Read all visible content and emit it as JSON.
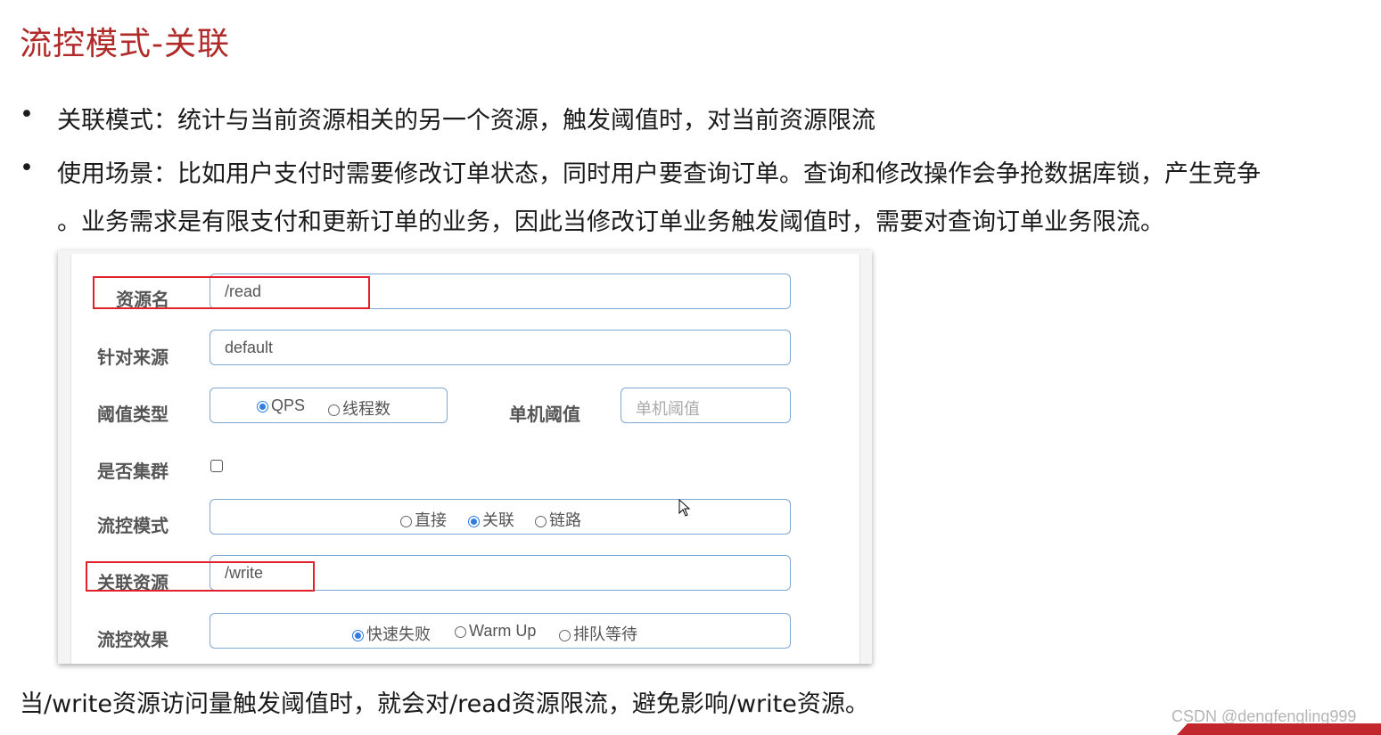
{
  "title": "流控模式-关联",
  "bullets": [
    {
      "symbol": "•",
      "text": "关联模式：统计与当前资源相关的另一个资源，触发阈值时，对当前资源限流"
    },
    {
      "symbol": "•",
      "text": "使用场景：比如用户支付时需要修改订单状态，同时用户要查询订单。查询和修改操作会争抢数据库锁，产生竞争",
      "text_line2": "。业务需求是有限支付和更新订单的业务，因此当修改订单业务触发阈值时，需要对查询订单业务限流。"
    }
  ],
  "form": {
    "resource_name": {
      "label": "资源名",
      "value": "/read"
    },
    "limit_app": {
      "label": "针对来源",
      "value": "default"
    },
    "grade": {
      "label": "阈值类型",
      "options": [
        "QPS",
        "线程数"
      ],
      "selected": "QPS"
    },
    "count": {
      "label": "单机阈值",
      "placeholder": "单机阈值"
    },
    "cluster": {
      "label": "是否集群",
      "checked": false
    },
    "strategy": {
      "label": "流控模式",
      "options": [
        "直接",
        "关联",
        "链路"
      ],
      "selected": "关联"
    },
    "ref_resource": {
      "label": "关联资源",
      "value": "/write"
    },
    "control_behavior": {
      "label": "流控效果",
      "options": [
        "快速失败",
        "Warm Up",
        "排队等待"
      ],
      "selected": "快速失败"
    }
  },
  "footer_text": "当/write资源访问量触发阈值时，就会对/read资源限流，避免影响/write资源。",
  "watermark": "CSDN @dengfengling999",
  "colors": {
    "title": "#b02a2a",
    "highlight": "#e0202a",
    "radio_selected": "#2f7de1",
    "field_border": "#7fa7d4"
  }
}
